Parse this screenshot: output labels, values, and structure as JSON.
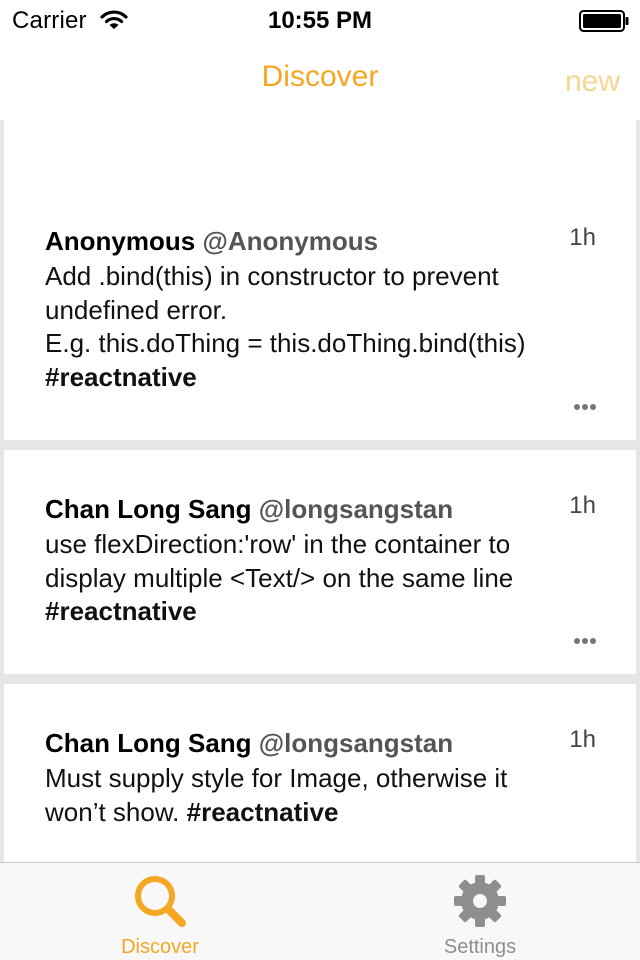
{
  "status_bar": {
    "carrier": "Carrier",
    "time": "10:55 PM",
    "icons": [
      "wifi-icon",
      "battery-icon"
    ]
  },
  "nav": {
    "title": "Discover",
    "right_button": "new",
    "title_color": "#f5a623",
    "right_button_color": "#f8d592"
  },
  "feed": {
    "items": [
      {
        "name": "",
        "handle": "",
        "time": "",
        "lines": []
      },
      {
        "name": "Anonymous",
        "handle": "@Anonymous",
        "time": "1h",
        "lines": [
          "Add .bind(this) in constructor to prevent",
          "undefined error.",
          "E.g. this.doThing = this.doThing.bind(this)"
        ],
        "hashtag": "#reactnative"
      },
      {
        "name": "Chan Long Sang",
        "handle": "@longsangstan",
        "time": "1h",
        "lines": [
          "use flexDirection:'row' in the container to",
          "display multiple <Text/> on the same line"
        ],
        "hashtag": "#reactnative"
      },
      {
        "name": "Chan Long Sang",
        "handle": "@longsangstan",
        "time": "1h",
        "lines": [
          "Must supply style for Image, otherwise it",
          "won’t show."
        ],
        "hashtag": "#reactnative"
      }
    ]
  },
  "tab_bar": {
    "tabs": [
      {
        "label": "Discover",
        "icon": "search-icon",
        "active": true,
        "color": "#f5a623"
      },
      {
        "label": "Settings",
        "icon": "gear-icon",
        "active": false,
        "color": "#8e8e8e"
      }
    ]
  }
}
